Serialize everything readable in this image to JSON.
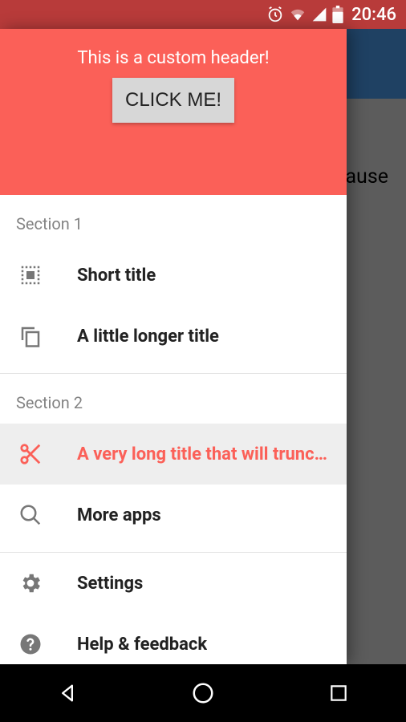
{
  "statusbar": {
    "time": "20:46"
  },
  "background": {
    "partial_text": "ause"
  },
  "header": {
    "text": "This is a custom header!",
    "button": "CLICK ME!"
  },
  "sections": {
    "s1": {
      "label": "Section 1",
      "items": [
        {
          "label": "Short title"
        },
        {
          "label": "A little longer title"
        }
      ]
    },
    "s2": {
      "label": "Section 2",
      "items": [
        {
          "label": "A very long title that will truncate…"
        },
        {
          "label": "More apps"
        }
      ]
    },
    "footer": {
      "items": [
        {
          "label": "Settings"
        },
        {
          "label": "Help & feedback"
        }
      ]
    }
  },
  "colors": {
    "accent": "#fb6058"
  }
}
